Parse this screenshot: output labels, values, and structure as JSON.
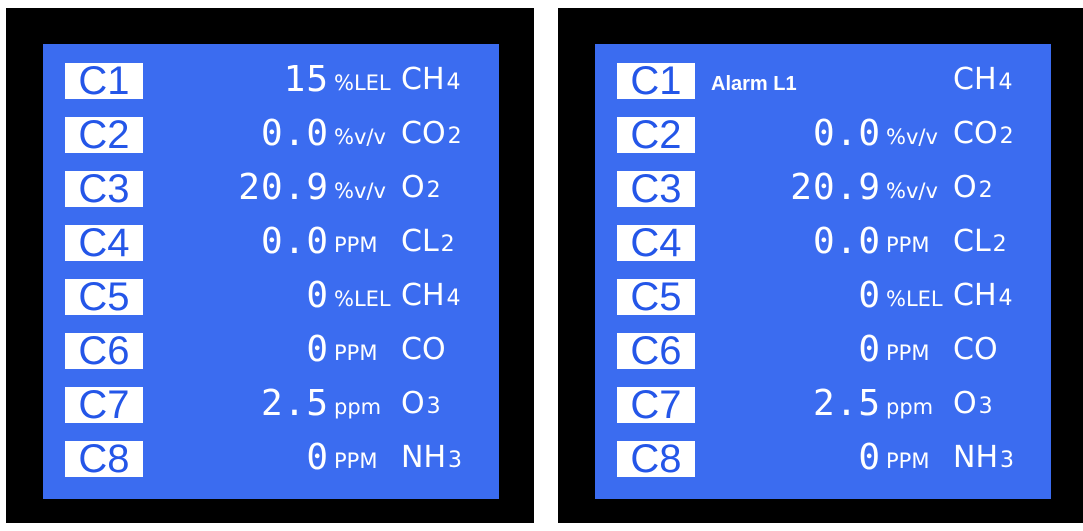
{
  "panels": [
    {
      "rows": [
        {
          "channel": "C1",
          "value": "15",
          "unit": "%LEL",
          "gas": "CH",
          "gas_sub": "4"
        },
        {
          "channel": "C2",
          "value": "0.0",
          "unit": "%v/v",
          "gas": "CO",
          "gas_sub": "2"
        },
        {
          "channel": "C3",
          "value": "20.9",
          "unit": "%v/v",
          "gas": "O",
          "gas_sub": "2"
        },
        {
          "channel": "C4",
          "value": "0.0",
          "unit": "PPM",
          "gas": "CL",
          "gas_sub": "2"
        },
        {
          "channel": "C5",
          "value": "0",
          "unit": "%LEL",
          "gas": "CH",
          "gas_sub": "4"
        },
        {
          "channel": "C6",
          "value": "0",
          "unit": "PPM",
          "gas": "CO",
          "gas_sub": ""
        },
        {
          "channel": "C7",
          "value": "2.5",
          "unit": "ppm",
          "gas": "O",
          "gas_sub": "3"
        },
        {
          "channel": "C8",
          "value": "0",
          "unit": "PPM",
          "gas": "NH",
          "gas_sub": "3"
        }
      ]
    },
    {
      "rows": [
        {
          "channel": "C1",
          "alarm": "Alarm L1",
          "gas": "CH",
          "gas_sub": "4"
        },
        {
          "channel": "C2",
          "value": "0.0",
          "unit": "%v/v",
          "gas": "CO",
          "gas_sub": "2"
        },
        {
          "channel": "C3",
          "value": "20.9",
          "unit": "%v/v",
          "gas": "O",
          "gas_sub": "2"
        },
        {
          "channel": "C4",
          "value": "0.0",
          "unit": "PPM",
          "gas": "CL",
          "gas_sub": "2"
        },
        {
          "channel": "C5",
          "value": "0",
          "unit": "%LEL",
          "gas": "CH",
          "gas_sub": "4"
        },
        {
          "channel": "C6",
          "value": "0",
          "unit": "PPM",
          "gas": "CO",
          "gas_sub": ""
        },
        {
          "channel": "C7",
          "value": "2.5",
          "unit": "ppm",
          "gas": "O",
          "gas_sub": "3"
        },
        {
          "channel": "C8",
          "value": "0",
          "unit": "PPM",
          "gas": "NH",
          "gas_sub": "3"
        }
      ]
    }
  ],
  "colors": {
    "screen": "#3b6cf0",
    "bezel": "#000000",
    "text": "#ffffff",
    "channel_box": "#ffffff",
    "channel_text": "#2456e8"
  }
}
